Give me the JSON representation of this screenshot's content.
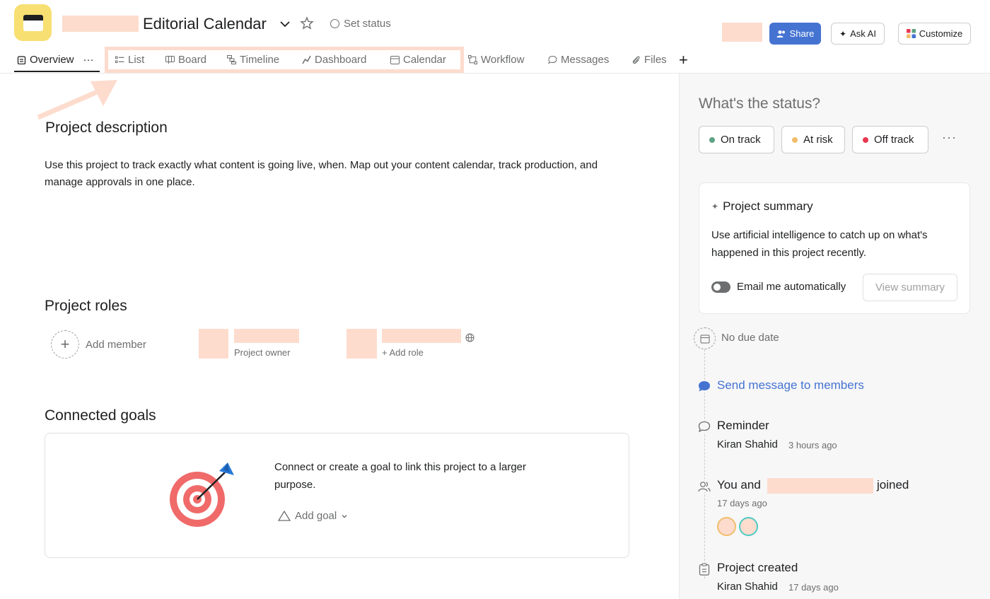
{
  "header": {
    "title": "Editorial Calendar",
    "set_status": "Set status",
    "share": "Share",
    "ask_ai": "Ask AI",
    "customize": "Customize"
  },
  "tabs": {
    "overview": "Overview",
    "overview_more": "···",
    "list": "List",
    "board": "Board",
    "timeline": "Timeline",
    "dashboard": "Dashboard",
    "calendar": "Calendar",
    "workflow": "Workflow",
    "messages": "Messages",
    "files": "Files",
    "add": "+"
  },
  "main": {
    "description_heading": "Project description",
    "description": "Use this project to track exactly what content is going live, when. Map out your content calendar, track production, and manage approvals in one place.",
    "roles_heading": "Project roles",
    "add_member": "Add member",
    "project_owner": "Project owner",
    "add_role": "+ Add role",
    "goals_heading": "Connected goals",
    "goal_text": "Connect or create a goal to link this project to a larger purpose.",
    "add_goal": "Add goal"
  },
  "status": {
    "question": "What's the status?",
    "on_track": "On track",
    "at_risk": "At risk",
    "off_track": "Off track",
    "more": "···",
    "colors": {
      "on_track": "#5da283",
      "at_risk": "#f1bd6c",
      "off_track": "#e8384f"
    }
  },
  "summary": {
    "title": "Project summary",
    "body": "Use artificial intelligence to catch up on what's happened in this project recently.",
    "email_label": "Email me automatically",
    "view_summary": "View summary"
  },
  "activity": {
    "no_due_date": "No due date",
    "send_message": "Send message to members",
    "reminder_title": "Reminder",
    "reminder_name": "Kiran Shahid",
    "reminder_time": "3 hours ago",
    "joined_prefix": "You and",
    "joined_suffix": "joined",
    "joined_time": "17 days ago",
    "created_title": "Project created",
    "created_name": "Kiran Shahid",
    "created_time": "17 days ago"
  },
  "colors": {
    "accent": "#4573d2",
    "app_icon": "#f8df72",
    "redaction": "#fddcce"
  }
}
